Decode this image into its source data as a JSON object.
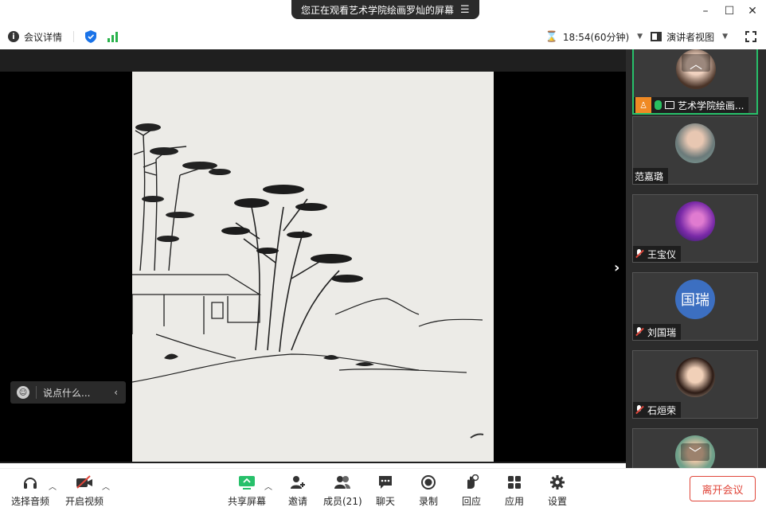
{
  "title_bar": {
    "sharing_text": "您正在观看艺术学院绘画罗灿的屏幕",
    "menu_icon": "menu-lines-icon",
    "minimize": "–",
    "maximize": "☐",
    "close": "✕"
  },
  "info_bar": {
    "meeting_details": "会议详情",
    "timer": "18:54(60分钟)",
    "view_label": "演讲者视图"
  },
  "chat": {
    "placeholder": "说点什么..."
  },
  "participants": [
    {
      "name": "艺术学院绘画...",
      "initials": "",
      "active": true
    },
    {
      "name": "范嘉璐",
      "initials": ""
    },
    {
      "name": "王宝仪",
      "initials": ""
    },
    {
      "name": "刘国瑞",
      "initials": "国瑞"
    },
    {
      "name": "石烜荣",
      "initials": ""
    },
    {
      "name": "",
      "initials": ""
    }
  ],
  "toolbar": {
    "audio": "选择音频",
    "video": "开启视频",
    "share": "共享屏幕",
    "invite": "邀请",
    "members": "成员(21)",
    "chat": "聊天",
    "record": "录制",
    "react": "回应",
    "apps": "应用",
    "settings": "设置",
    "leave": "离开会议"
  },
  "colors": {
    "accent_green": "#27c06a",
    "leave_red": "#e0463a",
    "share_pill": "#2b2b2b"
  }
}
